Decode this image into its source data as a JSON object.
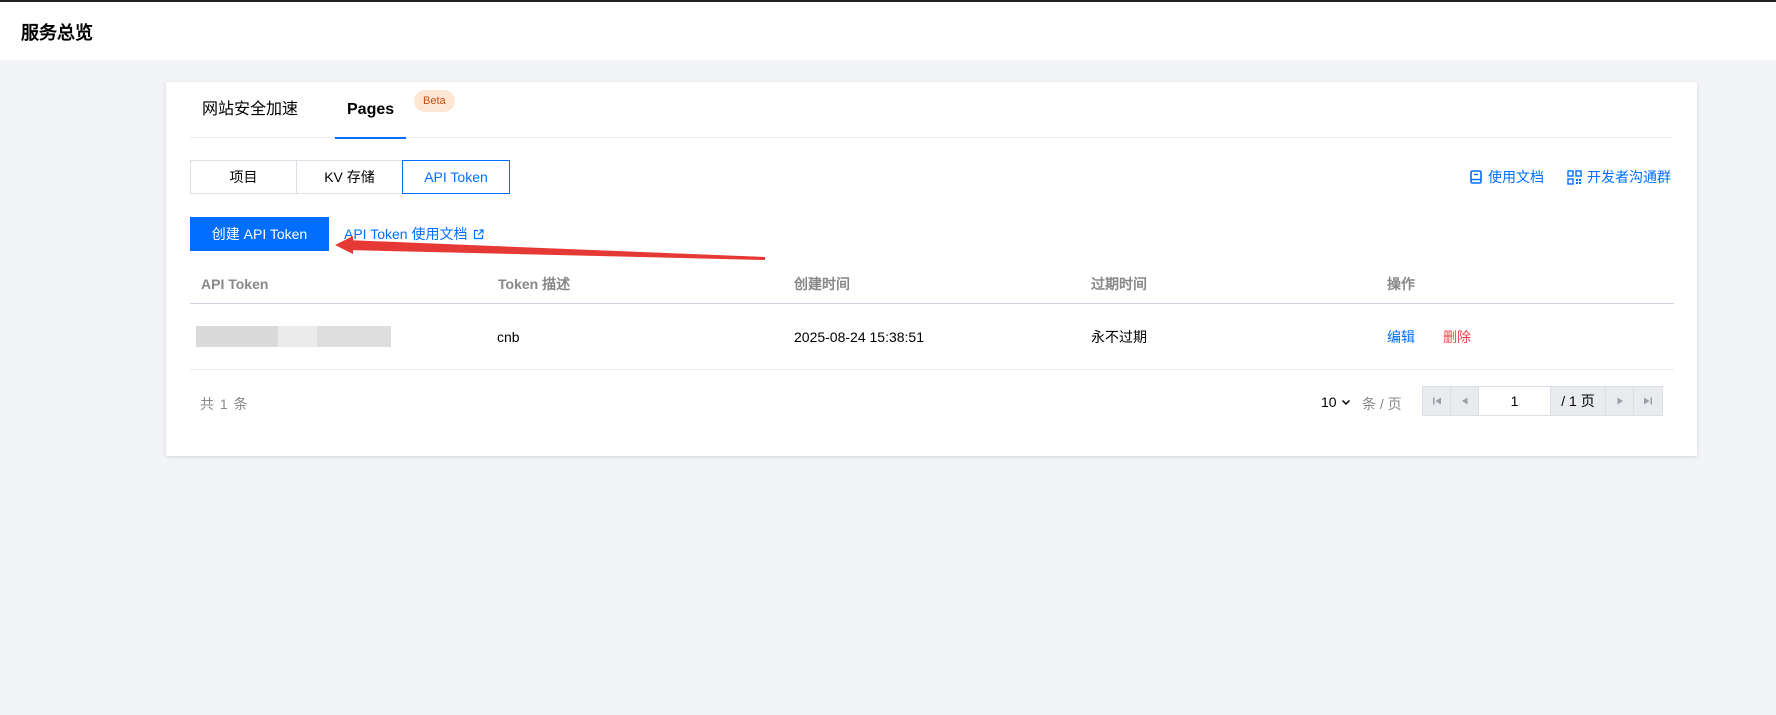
{
  "header": {
    "title": "服务总览"
  },
  "tabs": {
    "site_acceleration": "网站安全加速",
    "pages": "Pages",
    "beta_badge": "Beta"
  },
  "sub_tabs": [
    "项目",
    "KV 存储",
    "API Token"
  ],
  "links": {
    "usage_docs": "使用文档",
    "dev_group": "开发者沟通群"
  },
  "toolbar": {
    "create_button": "创建 API Token",
    "doc_link": "API Token 使用文档"
  },
  "table": {
    "headers": [
      "API Token",
      "Token 描述",
      "创建时间",
      "过期时间",
      "操作"
    ],
    "rows": [
      {
        "description": "cnb",
        "created": "2025-08-24 15:38:51",
        "expires": "永不过期",
        "edit": "编辑",
        "delete": "删除"
      }
    ]
  },
  "pagination": {
    "total": "共 1 条",
    "page_size": "10",
    "per_page_label": "条 / 页",
    "current_page": "1",
    "total_pages": "/ 1 页"
  },
  "colors": {
    "primary": "#006eff",
    "danger": "#e54545",
    "annotation_arrow": "#e53935"
  },
  "icons": [
    "book-icon",
    "qrcode-icon",
    "external-link-icon",
    "chevron-down-icon",
    "first-page-icon",
    "prev-page-icon",
    "next-page-icon",
    "last-page-icon"
  ]
}
